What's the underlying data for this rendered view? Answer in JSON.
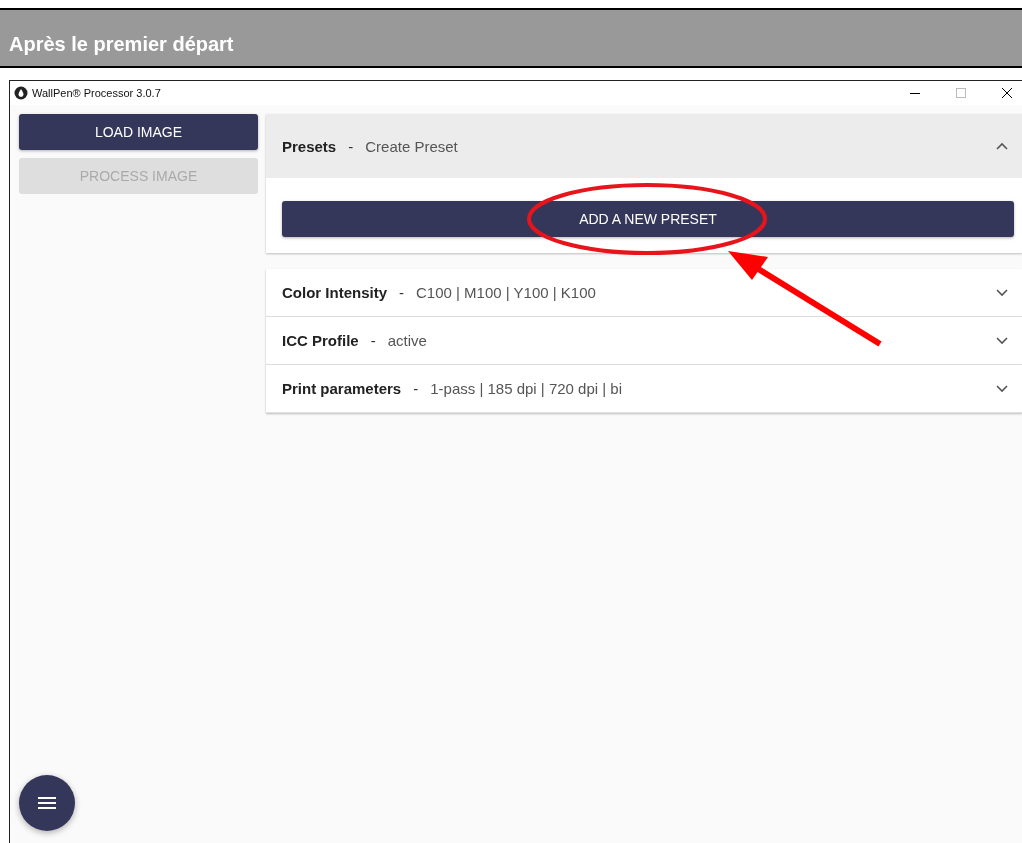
{
  "heading": "Après le premier départ",
  "window": {
    "title": "WallPen® Processor 3.0.7"
  },
  "sidebar": {
    "buttons": [
      {
        "label": "LOAD IMAGE",
        "disabled": false
      },
      {
        "label": "PROCESS IMAGE",
        "disabled": true
      }
    ]
  },
  "panels": [
    {
      "title": "Presets",
      "separator": "-",
      "summary": "Create Preset",
      "expanded": true,
      "action": "ADD A NEW PRESET"
    },
    {
      "title": "Color Intensity",
      "separator": "-",
      "summary": "C100 | M100 | Y100 | K100",
      "expanded": false
    },
    {
      "title": "ICC Profile",
      "separator": "-",
      "summary": "active",
      "expanded": false
    },
    {
      "title": "Print parameters",
      "separator": "-",
      "summary": "1-pass | 185 dpi | 720 dpi | bi",
      "expanded": false
    }
  ]
}
